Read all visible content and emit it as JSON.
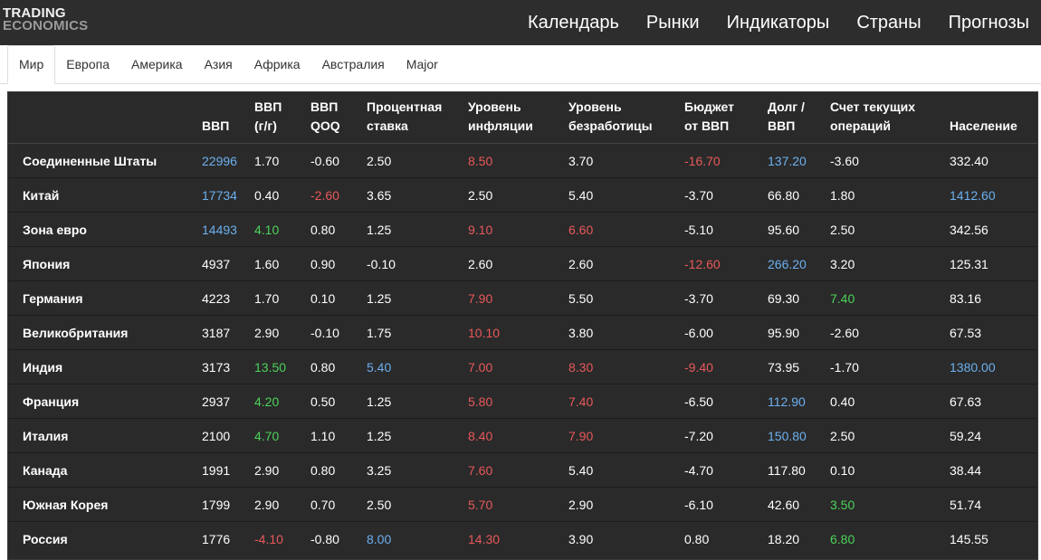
{
  "logo": {
    "line1": "TRADING",
    "line2": "ECONOMICS"
  },
  "nav": [
    "Календарь",
    "Рынки",
    "Индикаторы",
    "Страны",
    "Прогнозы"
  ],
  "tabs": [
    "Мир",
    "Европа",
    "Америка",
    "Азия",
    "Африка",
    "Австралия",
    "Major"
  ],
  "active_tab": "Мир",
  "colors": {
    "positive": "#4cd25a",
    "negative": "#e8585a",
    "highlight": "#6cb0f0"
  },
  "table": {
    "headers": [
      [
        "",
        ""
      ],
      [
        "",
        "ВВП"
      ],
      [
        "ВВП",
        "(г/г)"
      ],
      [
        "ВВП",
        "QOQ"
      ],
      [
        "Процентная",
        "ставка"
      ],
      [
        "Уровень",
        "инфляции"
      ],
      [
        "Уровень",
        "безработицы"
      ],
      [
        "Бюджет",
        "от ВВП"
      ],
      [
        "Долг /",
        "ВВП"
      ],
      [
        "Счет текущих",
        "операций"
      ],
      [
        "",
        "Население"
      ]
    ],
    "rows": [
      {
        "cells": [
          "Соединенные Штаты",
          "22996",
          "1.70",
          "-0.60",
          "2.50",
          "8.50",
          "3.70",
          "-16.70",
          "137.20",
          "-3.60",
          "332.40"
        ],
        "colors": [
          "",
          "blue",
          "",
          "",
          "",
          "red",
          "",
          "red",
          "blue",
          "",
          ""
        ]
      },
      {
        "cells": [
          "Китай",
          "17734",
          "0.40",
          "-2.60",
          "3.65",
          "2.50",
          "5.40",
          "-3.70",
          "66.80",
          "1.80",
          "1412.60"
        ],
        "colors": [
          "",
          "blue",
          "",
          "red",
          "",
          "",
          "",
          "",
          "",
          "",
          "blue"
        ]
      },
      {
        "cells": [
          "Зона евро",
          "14493",
          "4.10",
          "0.80",
          "1.25",
          "9.10",
          "6.60",
          "-5.10",
          "95.60",
          "2.50",
          "342.56"
        ],
        "colors": [
          "",
          "blue",
          "green",
          "",
          "",
          "red",
          "red",
          "",
          "",
          "",
          ""
        ]
      },
      {
        "cells": [
          "Япония",
          "4937",
          "1.60",
          "0.90",
          "-0.10",
          "2.60",
          "2.60",
          "-12.60",
          "266.20",
          "3.20",
          "125.31"
        ],
        "colors": [
          "",
          "",
          "",
          "",
          "",
          "",
          "",
          "red",
          "blue",
          "",
          ""
        ]
      },
      {
        "cells": [
          "Германия",
          "4223",
          "1.70",
          "0.10",
          "1.25",
          "7.90",
          "5.50",
          "-3.70",
          "69.30",
          "7.40",
          "83.16"
        ],
        "colors": [
          "",
          "",
          "",
          "",
          "",
          "red",
          "",
          "",
          "",
          "green",
          ""
        ]
      },
      {
        "cells": [
          "Великобритания",
          "3187",
          "2.90",
          "-0.10",
          "1.75",
          "10.10",
          "3.80",
          "-6.00",
          "95.90",
          "-2.60",
          "67.53"
        ],
        "colors": [
          "",
          "",
          "",
          "",
          "",
          "red",
          "",
          "",
          "",
          "",
          ""
        ]
      },
      {
        "cells": [
          "Индия",
          "3173",
          "13.50",
          "0.80",
          "5.40",
          "7.00",
          "8.30",
          "-9.40",
          "73.95",
          "-1.70",
          "1380.00"
        ],
        "colors": [
          "",
          "",
          "green",
          "",
          "blue",
          "red",
          "red",
          "red",
          "",
          "",
          "blue"
        ]
      },
      {
        "cells": [
          "Франция",
          "2937",
          "4.20",
          "0.50",
          "1.25",
          "5.80",
          "7.40",
          "-6.50",
          "112.90",
          "0.40",
          "67.63"
        ],
        "colors": [
          "",
          "",
          "green",
          "",
          "",
          "red",
          "red",
          "",
          "blue",
          "",
          ""
        ]
      },
      {
        "cells": [
          "Италия",
          "2100",
          "4.70",
          "1.10",
          "1.25",
          "8.40",
          "7.90",
          "-7.20",
          "150.80",
          "2.50",
          "59.24"
        ],
        "colors": [
          "",
          "",
          "green",
          "",
          "",
          "red",
          "red",
          "",
          "blue",
          "",
          ""
        ]
      },
      {
        "cells": [
          "Канада",
          "1991",
          "2.90",
          "0.80",
          "3.25",
          "7.60",
          "5.40",
          "-4.70",
          "117.80",
          "0.10",
          "38.44"
        ],
        "colors": [
          "",
          "",
          "",
          "",
          "",
          "red",
          "",
          "",
          "",
          "",
          ""
        ]
      },
      {
        "cells": [
          "Южная Корея",
          "1799",
          "2.90",
          "0.70",
          "2.50",
          "5.70",
          "2.90",
          "-6.10",
          "42.60",
          "3.50",
          "51.74"
        ],
        "colors": [
          "",
          "",
          "",
          "",
          "",
          "red",
          "",
          "",
          "",
          "green",
          ""
        ]
      },
      {
        "cells": [
          "Россия",
          "1776",
          "-4.10",
          "-0.80",
          "8.00",
          "14.30",
          "3.90",
          "0.80",
          "18.20",
          "6.80",
          "145.55"
        ],
        "colors": [
          "",
          "",
          "red",
          "",
          "blue",
          "red",
          "",
          "",
          "",
          "green",
          ""
        ]
      }
    ]
  }
}
